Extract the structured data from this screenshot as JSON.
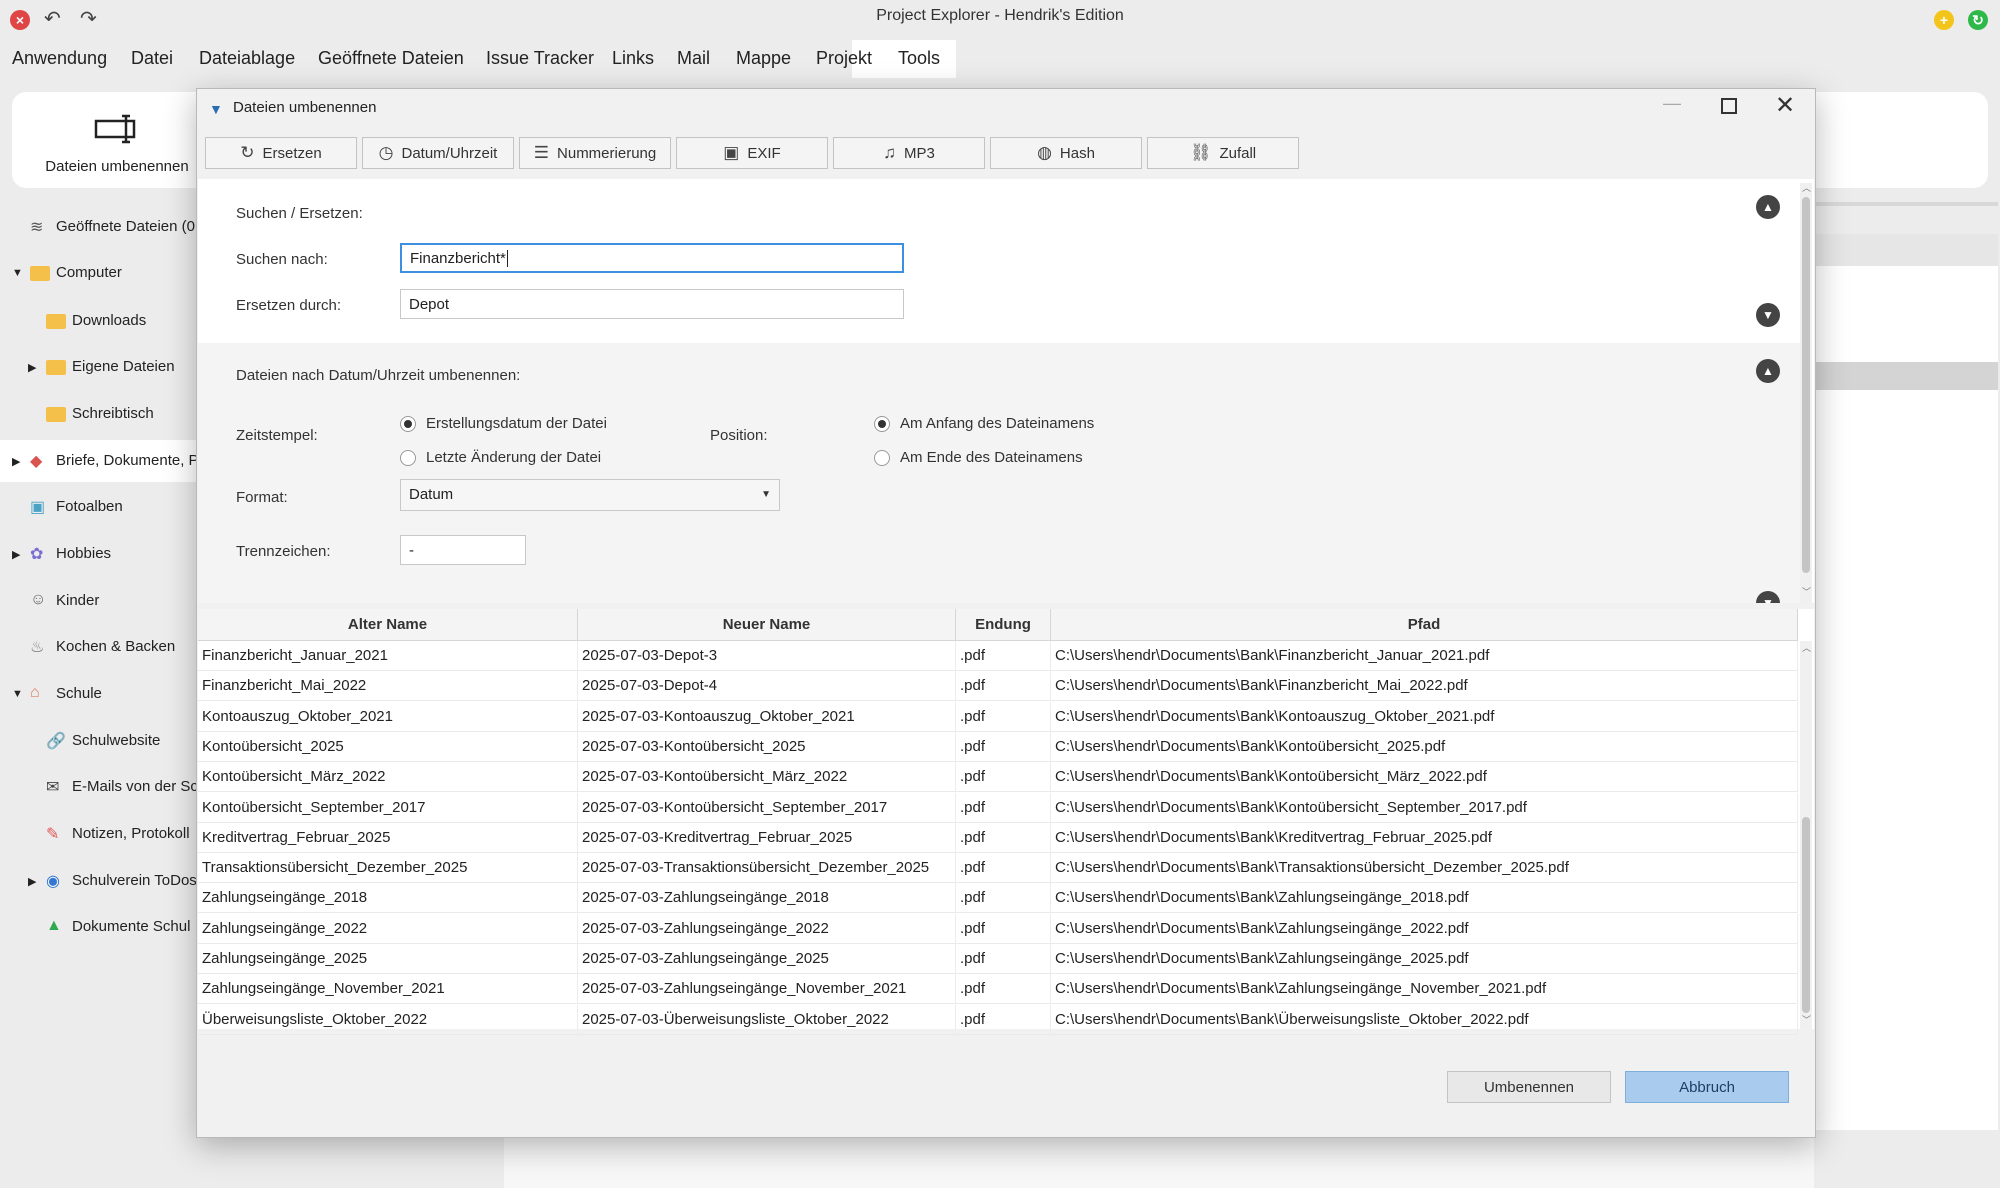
{
  "window": {
    "title": "Project Explorer - Hendrik's Edition"
  },
  "menu": [
    "Anwendung",
    "Datei",
    "Dateiablage",
    "Geöffnete Dateien",
    "Issue Tracker",
    "Links",
    "Mail",
    "Mappe",
    "Projekt",
    "Tools"
  ],
  "ribbon": {
    "rename_label": "Dateien umbenennen"
  },
  "sidebar": {
    "items": [
      {
        "label": "Geöffnete Dateien (0"
      },
      {
        "label": "Computer"
      },
      {
        "label": "Downloads"
      },
      {
        "label": "Eigene Dateien"
      },
      {
        "label": "Schreibtisch"
      },
      {
        "label": "Briefe, Dokumente, P"
      },
      {
        "label": "Fotoalben"
      },
      {
        "label": "Hobbies"
      },
      {
        "label": "Kinder"
      },
      {
        "label": "Kochen & Backen"
      },
      {
        "label": "Schule"
      },
      {
        "label": "Schulwebsite"
      },
      {
        "label": "E-Mails von der Sc"
      },
      {
        "label": "Notizen, Protokoll"
      },
      {
        "label": "Schulverein ToDos"
      },
      {
        "label": "Dokumente Schul"
      }
    ]
  },
  "dialog": {
    "title": "Dateien umbenennen",
    "tabs": [
      "Ersetzen",
      "Datum/Uhrzeit",
      "Nummerierung",
      "EXIF",
      "MP3",
      "Hash",
      "Zufall"
    ],
    "search_section": {
      "heading": "Suchen / Ersetzen:",
      "search_label": "Suchen nach:",
      "search_value": "Finanzbericht*",
      "replace_label": "Ersetzen durch:",
      "replace_value": "Depot"
    },
    "date_section": {
      "heading": "Dateien nach Datum/Uhrzeit umbenennen:",
      "timestamp_label": "Zeitstempel:",
      "timestamp_options": [
        "Erstellungsdatum der Datei",
        "Letzte Änderung der Datei"
      ],
      "timestamp_selected": 0,
      "position_label": "Position:",
      "position_options": [
        "Am Anfang des Dateinamens",
        "Am Ende des Dateinamens"
      ],
      "position_selected": 0,
      "format_label": "Format:",
      "format_value": "Datum",
      "separator_label": "Trennzeichen:",
      "separator_value": "-"
    },
    "table": {
      "columns": [
        "Alter Name",
        "Neuer Name",
        "Endung",
        "Pfad"
      ],
      "rows": [
        [
          "Finanzbericht_Januar_2021",
          "2025-07-03-Depot-3",
          ".pdf",
          "C:\\Users\\hendr\\Documents\\Bank\\Finanzbericht_Januar_2021.pdf"
        ],
        [
          "Finanzbericht_Mai_2022",
          "2025-07-03-Depot-4",
          ".pdf",
          "C:\\Users\\hendr\\Documents\\Bank\\Finanzbericht_Mai_2022.pdf"
        ],
        [
          "Kontoauszug_Oktober_2021",
          "2025-07-03-Kontoauszug_Oktober_2021",
          ".pdf",
          "C:\\Users\\hendr\\Documents\\Bank\\Kontoauszug_Oktober_2021.pdf"
        ],
        [
          "Kontoübersicht_2025",
          "2025-07-03-Kontoübersicht_2025",
          ".pdf",
          "C:\\Users\\hendr\\Documents\\Bank\\Kontoübersicht_2025.pdf"
        ],
        [
          "Kontoübersicht_März_2022",
          "2025-07-03-Kontoübersicht_März_2022",
          ".pdf",
          "C:\\Users\\hendr\\Documents\\Bank\\Kontoübersicht_März_2022.pdf"
        ],
        [
          "Kontoübersicht_September_2017",
          "2025-07-03-Kontoübersicht_September_2017",
          ".pdf",
          "C:\\Users\\hendr\\Documents\\Bank\\Kontoübersicht_September_2017.pdf"
        ],
        [
          "Kreditvertrag_Februar_2025",
          "2025-07-03-Kreditvertrag_Februar_2025",
          ".pdf",
          "C:\\Users\\hendr\\Documents\\Bank\\Kreditvertrag_Februar_2025.pdf"
        ],
        [
          "Transaktionsübersicht_Dezember_2025",
          "2025-07-03-Transaktionsübersicht_Dezember_2025",
          ".pdf",
          "C:\\Users\\hendr\\Documents\\Bank\\Transaktionsübersicht_Dezember_2025.pdf"
        ],
        [
          "Zahlungseingänge_2018",
          "2025-07-03-Zahlungseingänge_2018",
          ".pdf",
          "C:\\Users\\hendr\\Documents\\Bank\\Zahlungseingänge_2018.pdf"
        ],
        [
          "Zahlungseingänge_2022",
          "2025-07-03-Zahlungseingänge_2022",
          ".pdf",
          "C:\\Users\\hendr\\Documents\\Bank\\Zahlungseingänge_2022.pdf"
        ],
        [
          "Zahlungseingänge_2025",
          "2025-07-03-Zahlungseingänge_2025",
          ".pdf",
          "C:\\Users\\hendr\\Documents\\Bank\\Zahlungseingänge_2025.pdf"
        ],
        [
          "Zahlungseingänge_November_2021",
          "2025-07-03-Zahlungseingänge_November_2021",
          ".pdf",
          "C:\\Users\\hendr\\Documents\\Bank\\Zahlungseingänge_November_2021.pdf"
        ],
        [
          "Überweisungsliste_Oktober_2022",
          "2025-07-03-Überweisungsliste_Oktober_2022",
          ".pdf",
          "C:\\Users\\hendr\\Documents\\Bank\\Überweisungsliste_Oktober_2022.pdf"
        ]
      ]
    },
    "buttons": {
      "rename": "Umbenennen",
      "cancel": "Abbruch"
    }
  },
  "colors": {
    "primary_button": "#a9cbee",
    "focus_border": "#3d8fe0",
    "close_red": "#e04545",
    "yellow": "#f3c51b",
    "green": "#2fb84a"
  }
}
